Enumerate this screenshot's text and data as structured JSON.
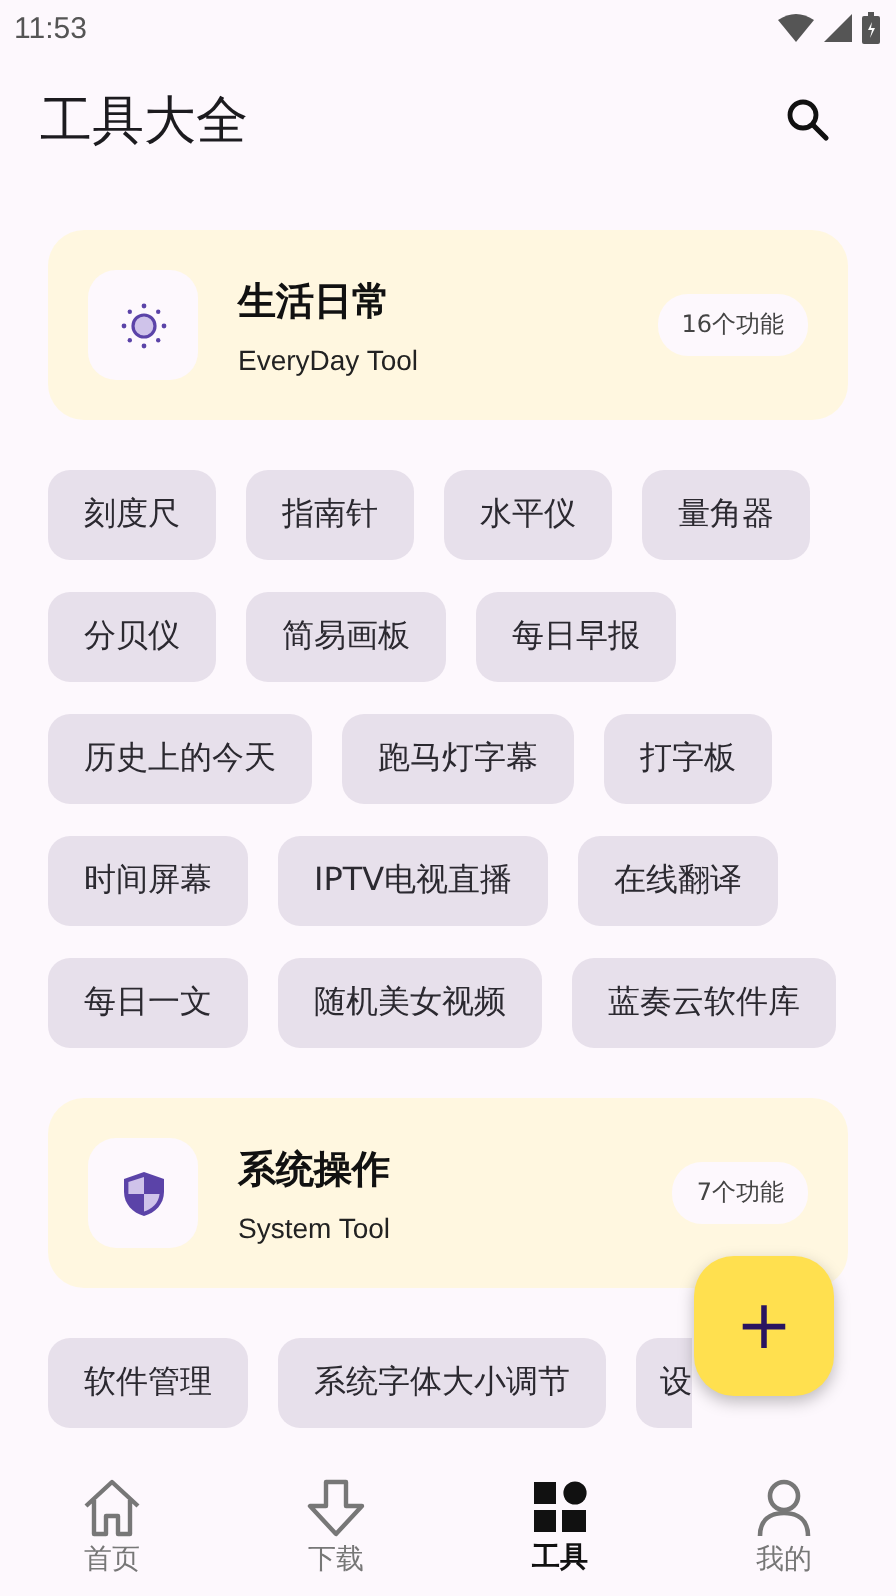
{
  "status_bar": {
    "time": "11:53"
  },
  "header": {
    "title": "工具大全"
  },
  "sections": [
    {
      "title": "生活日常",
      "subtitle": "EveryDay Tool",
      "count": "16个功能",
      "kind": "sun",
      "tools": [
        "刻度尺",
        "指南针",
        "水平仪",
        "量角器",
        "分贝仪",
        "简易画板",
        "每日早报",
        "历史上的今天",
        "跑马灯字幕",
        "打字板",
        "时间屏幕",
        "IPTV电视直播",
        "在线翻译",
        "每日一文",
        "随机美女视频",
        "蓝奏云软件库"
      ]
    },
    {
      "title": "系统操作",
      "subtitle": "System Tool",
      "count": "7个功能",
      "kind": "shield",
      "tools": [
        "软件管理",
        "系统字体大小调节",
        "设"
      ]
    }
  ],
  "fab": {
    "label": "+"
  },
  "nav": [
    {
      "label": "首页",
      "kind": "home",
      "selected": false
    },
    {
      "label": "下载",
      "kind": "download",
      "selected": false
    },
    {
      "label": "工具",
      "kind": "tools",
      "selected": true
    },
    {
      "label": "我的",
      "kind": "person",
      "selected": false
    }
  ]
}
